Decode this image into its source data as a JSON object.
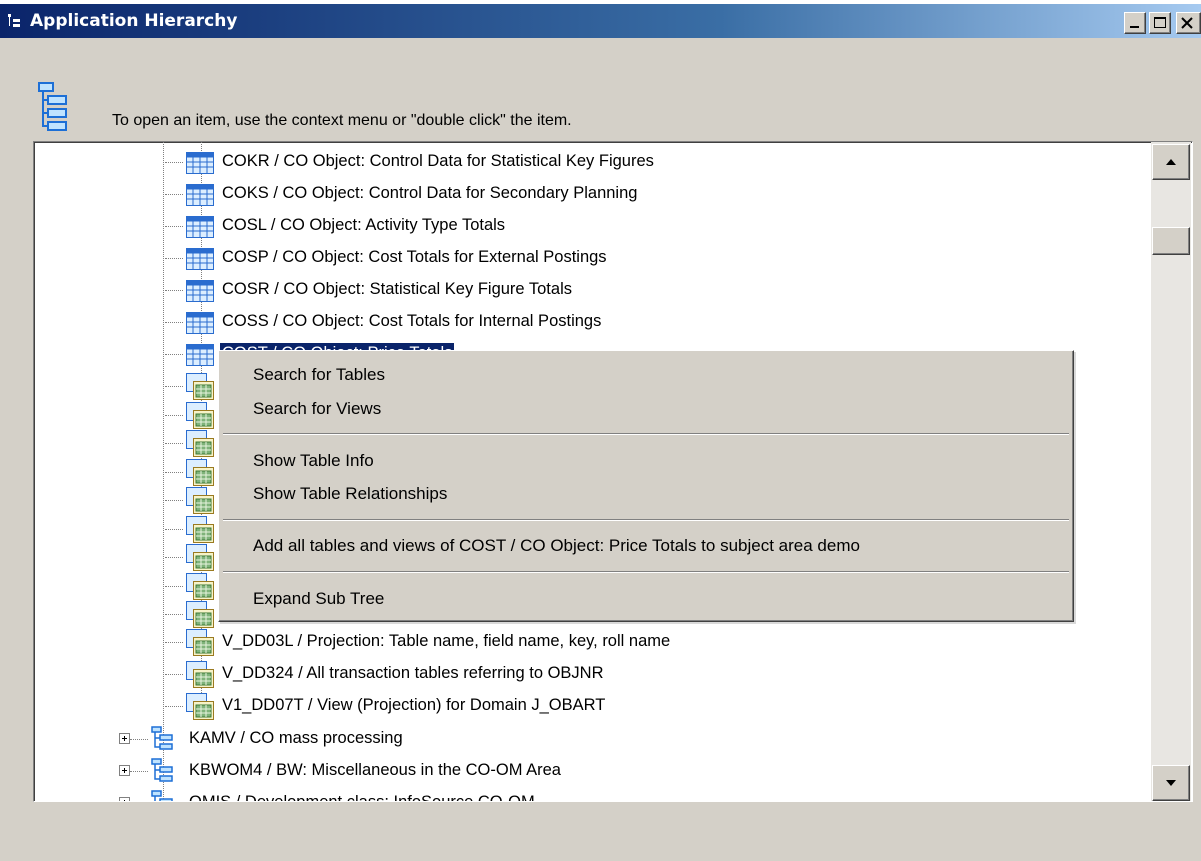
{
  "window": {
    "title": "Application Hierarchy",
    "hint": "To open an item, use the context menu or \"double click\" the item."
  },
  "tree": {
    "items": [
      {
        "label": "COKR / CO Object: Control Data for Statistical Key Figures",
        "icon": "table-icon"
      },
      {
        "label": "COKS / CO Object: Control Data for Secondary Planning",
        "icon": "table-icon"
      },
      {
        "label": "COSL / CO Object: Activity Type Totals",
        "icon": "table-icon"
      },
      {
        "label": "COSP / CO Object: Cost Totals for External Postings",
        "icon": "table-icon"
      },
      {
        "label": "COSR / CO Object: Statistical Key Figure Totals",
        "icon": "table-icon"
      },
      {
        "label": "COSS / CO Object: Cost Totals for Internal Postings",
        "icon": "table-icon"
      },
      {
        "label": "COST / CO Object: Price Totals",
        "icon": "table-icon",
        "selected": true
      },
      {
        "label": "V_DD03L / Projection: Table name, field name, key, roll name",
        "icon": "view-icon"
      },
      {
        "label": "V_DD324 / All transaction tables referring to OBJNR",
        "icon": "view-icon"
      },
      {
        "label": "V1_DD07T / View (Projection) for Domain J_OBART",
        "icon": "view-icon"
      }
    ],
    "folders": [
      {
        "label": "KAMV / CO mass processing",
        "icon": "hierarchy-icon"
      },
      {
        "label": "KBWOM4 / BW: Miscellaneous in the CO-OM Area",
        "icon": "hierarchy-icon"
      },
      {
        "label": "OMIS / Development class: InfoSource CO-OM",
        "icon": "hierarchy-icon"
      }
    ]
  },
  "context_menu": {
    "items": [
      "Search for Tables",
      "Search for Views",
      "Show Table Info",
      "Show Table Relationships",
      "Add all tables and views of COST / CO Object: Price Totals to subject area demo",
      "Expand Sub Tree"
    ]
  },
  "colors": {
    "title_start": "#0a246a",
    "title_end": "#a6caf0",
    "face": "#d4d0c8",
    "selection": "#0a246a"
  }
}
